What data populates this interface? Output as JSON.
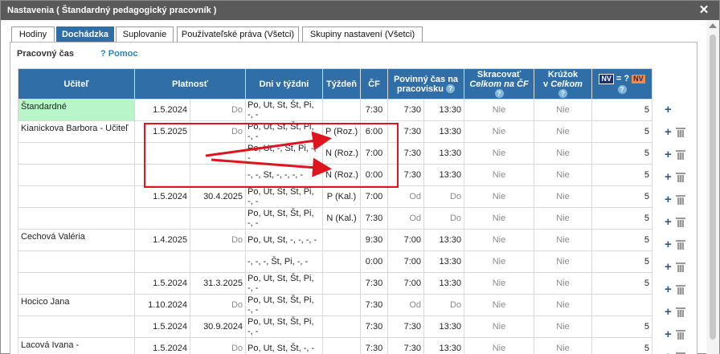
{
  "window": {
    "title": "Nastavenia ( Štandardný pedagogický pracovník )",
    "close_glyph": "✕"
  },
  "tabs": [
    {
      "label": "Hodiny",
      "active": false
    },
    {
      "label": "Dochádzka",
      "active": true
    },
    {
      "label": "Suplovanie",
      "active": false
    },
    {
      "label": "Používateľské práva (Všetci)",
      "active": false
    },
    {
      "label": "Skupiny nastavení (Všetci)",
      "active": false
    }
  ],
  "section": {
    "title": "Pracovný čas",
    "help_icon": "?",
    "help_label": "Pomoc"
  },
  "table": {
    "headers": {
      "teacher": "Učiteľ",
      "validity": "Platnosť",
      "days": "Dni v týždni",
      "week": "Týždeň",
      "cf": "ČF",
      "required_line1": "Povinný čas na",
      "required_line2": "pracovisku",
      "shorten_line1": "Skracovať",
      "shorten_line2": "Celkom na ČF",
      "club_line1": "Krúžok",
      "club_line2_prefix": "v ",
      "club_line2_italic": "Celkom",
      "nv_left": "NV",
      "nv_middle": " = ? ",
      "nv_right": "NV",
      "help_icon": "?"
    },
    "rows": [
      {
        "teacher": "Štandardné",
        "from": "1.5.2024",
        "to": "Do",
        "to_muted": true,
        "days": "Po, Ut, St, Št, Pi, -, -",
        "week": "",
        "cf": "7:30",
        "from_time": "7:30",
        "from_muted": false,
        "to_time": "13:30",
        "to_time_muted": false,
        "shorten": "Nie",
        "club": "Nie",
        "nv": "5",
        "std": true,
        "plus": true,
        "trash": false
      },
      {
        "teacher": "Kianickova Barbora - Učiteľ",
        "from": "1.5.2025",
        "to": "Do",
        "to_muted": true,
        "days": "Po, Ut, St, Št, Pi, -, -",
        "week": "P (Roz.)",
        "cf": "6:00",
        "from_time": "7:30",
        "from_muted": false,
        "to_time": "13:30",
        "to_time_muted": false,
        "shorten": "Nie",
        "club": "Nie",
        "nv": "5",
        "std": false,
        "plus": true,
        "trash": true
      },
      {
        "teacher": "",
        "from": "",
        "to": "",
        "to_muted": false,
        "days": "Po, Ut, -, Št, Pi, -, -",
        "week": "N (Roz.)",
        "cf": "7:00",
        "from_time": "7:30",
        "from_muted": false,
        "to_time": "13:30",
        "to_time_muted": false,
        "shorten": "Nie",
        "club": "Nie",
        "nv": "5",
        "std": false,
        "plus": true,
        "trash": true
      },
      {
        "teacher": "",
        "from": "",
        "to": "",
        "to_muted": false,
        "days": "-, -, St, -, -, -, -",
        "week": "N (Roz.)",
        "cf": "0:00",
        "from_time": "7:30",
        "from_muted": false,
        "to_time": "13:30",
        "to_time_muted": false,
        "shorten": "Nie",
        "club": "Nie",
        "nv": "5",
        "std": false,
        "plus": true,
        "trash": true
      },
      {
        "teacher": "",
        "from": "1.5.2024",
        "to": "30.4.2025",
        "to_muted": false,
        "days": "Po, Ut, St, Št, Pi, -, -",
        "week": "P (Kal.)",
        "cf": "7:00",
        "from_time": "Od",
        "from_muted": true,
        "to_time": "Do",
        "to_time_muted": true,
        "shorten": "Nie",
        "club": "Nie",
        "nv": "5",
        "std": false,
        "plus": true,
        "trash": true
      },
      {
        "teacher": "",
        "from": "",
        "to": "",
        "to_muted": false,
        "days": "Po, Ut, St, Št, Pi, -, -",
        "week": "N (Kal.)",
        "cf": "7:30",
        "from_time": "Od",
        "from_muted": true,
        "to_time": "Do",
        "to_time_muted": true,
        "shorten": "Nie",
        "club": "Nie",
        "nv": "5",
        "std": false,
        "plus": true,
        "trash": true
      },
      {
        "teacher": "Cechová Valéria",
        "from": "1.4.2025",
        "to": "Do",
        "to_muted": true,
        "days": "Po, Ut, St, -, -, -, -",
        "week": "",
        "cf": "9:30",
        "from_time": "7:00",
        "from_muted": false,
        "to_time": "13:30",
        "to_time_muted": false,
        "shorten": "Nie",
        "club": "Nie",
        "nv": "5",
        "std": false,
        "plus": true,
        "trash": true
      },
      {
        "teacher": "",
        "from": "",
        "to": "",
        "to_muted": false,
        "days": "-, -, -, Št, Pi, -, -",
        "week": "",
        "cf": "0:00",
        "from_time": "7:00",
        "from_muted": false,
        "to_time": "13:30",
        "to_time_muted": false,
        "shorten": "Nie",
        "club": "Nie",
        "nv": "5",
        "std": false,
        "plus": true,
        "trash": true
      },
      {
        "teacher": "",
        "from": "1.5.2024",
        "to": "31.3.2025",
        "to_muted": false,
        "days": "Po, Ut, St, Št, Pi, -, -",
        "week": "",
        "cf": "7:30",
        "from_time": "7:00",
        "from_muted": false,
        "to_time": "13:30",
        "to_time_muted": false,
        "shorten": "Nie",
        "club": "Nie",
        "nv": "5",
        "std": false,
        "plus": true,
        "trash": true
      },
      {
        "teacher": "Hocico Jana",
        "from": "1.10.2024",
        "to": "Do",
        "to_muted": true,
        "days": "Po, Ut, St, Št, Pi, -, -",
        "week": "",
        "cf": "7:30",
        "from_time": "Od",
        "from_muted": true,
        "to_time": "Do",
        "to_time_muted": true,
        "shorten": "Nie",
        "club": "Nie",
        "nv": "",
        "std": false,
        "plus": true,
        "trash": true
      },
      {
        "teacher": "",
        "from": "1.5.2024",
        "to": "30.9.2024",
        "to_muted": false,
        "days": "Po, Ut, St, Št, Pi, -, -",
        "week": "",
        "cf": "7:30",
        "from_time": "7:30",
        "from_muted": false,
        "to_time": "13:30",
        "to_time_muted": false,
        "shorten": "Nie",
        "club": "Nie",
        "nv": "5",
        "std": false,
        "plus": true,
        "trash": true
      },
      {
        "teacher": "Lacová Ivana -",
        "from": "1.5.2024",
        "to": "Do",
        "to_muted": true,
        "days": "Po, Ut, St, Št, -, -",
        "week": "",
        "cf": "7:30",
        "from_time": "7:30",
        "from_muted": false,
        "to_time": "13:30",
        "to_time_muted": false,
        "shorten": "Nie",
        "club": "Nie",
        "nv": "5",
        "std": false,
        "plus": true,
        "trash": true
      }
    ]
  },
  "annotation": {
    "box_color": "#e0141e",
    "arrow_color": "#e0141e"
  }
}
